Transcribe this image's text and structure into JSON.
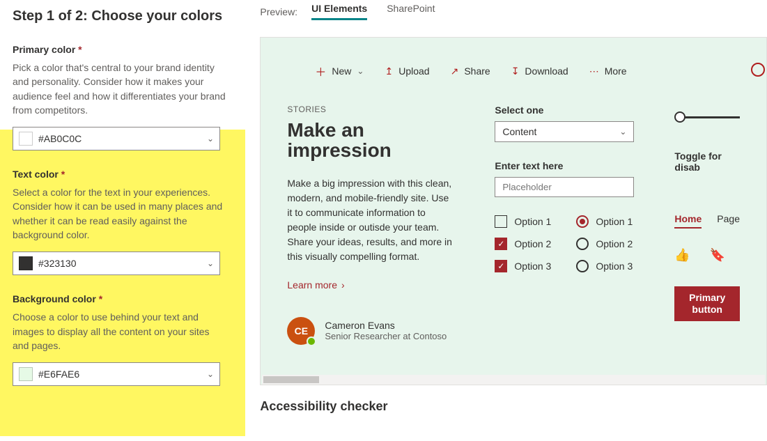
{
  "left": {
    "step_title": "Step 1 of 2: Choose your colors",
    "primary": {
      "label": "Primary color",
      "req": "*",
      "desc": "Pick a color that's central to your brand identity and personality. Consider how it makes your audience feel and how it differentiates your brand from competitors.",
      "hex": "#AB0C0C",
      "swatch": "#AB0C0C"
    },
    "text": {
      "label": "Text color",
      "req": "*",
      "desc": "Select a color for the text in your experiences. Consider how it can be used in many places and whether it can be read easily against the background color.",
      "hex": "#323130",
      "swatch": "#323130"
    },
    "background": {
      "label": "Background color",
      "req": "*",
      "desc": "Choose a color to use behind your text and images to display all the content on your sites and pages.",
      "hex": "#E6FAE6",
      "swatch": "#E6FAE6"
    }
  },
  "preview": {
    "label": "Preview:",
    "tabs": {
      "ui": "UI Elements",
      "sharepoint": "SharePoint"
    }
  },
  "cmd": {
    "new": "New",
    "upload": "Upload",
    "share": "Share",
    "download": "Download",
    "more": "More"
  },
  "hero": {
    "stories": "STORIES",
    "title": "Make an impression",
    "desc": "Make a big impression with this clean, modern, and mobile-friendly site. Use it to communicate information to people inside or outisde your team. Share your ideas, results, and more in this visually compelling format.",
    "learn_more": "Learn more"
  },
  "persona": {
    "initials": "CE",
    "name": "Cameron Evans",
    "role": "Senior Researcher at Contoso"
  },
  "form": {
    "select_label": "Select one",
    "select_value": "Content",
    "enter_label": "Enter text here",
    "placeholder": "Placeholder",
    "chk": {
      "o1": "Option 1",
      "o2": "Option 2",
      "o3": "Option 3"
    },
    "rad": {
      "o1": "Option 1",
      "o2": "Option 2",
      "o3": "Option 3"
    }
  },
  "col3": {
    "toggle_label": "Toggle for disab",
    "nav_home": "Home",
    "nav_page": "Page",
    "primary_btn": "Primary button"
  },
  "accessibility_header": "Accessibility checker"
}
